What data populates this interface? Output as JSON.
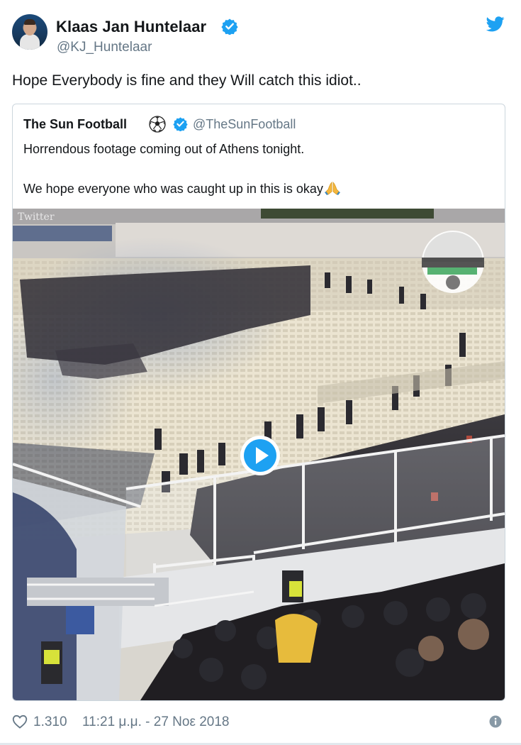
{
  "author": {
    "display_name": "Klaas Jan Huntelaar",
    "handle": "@KJ_Huntelaar",
    "verified": true
  },
  "tweet": {
    "text": "Hope Everybody is fine and they Will catch this idiot.."
  },
  "quoted_tweet": {
    "display_name": "The Sun Football",
    "name_emoji_icon": "soccer-ball-icon",
    "verified": true,
    "handle": "@TheSunFootball",
    "line1": "Horrendous footage coming out of Athens tonight.",
    "line2": "We hope everyone who was caught up in this is okay",
    "line2_emoji_icon": "folded-hands-icon",
    "media": {
      "type": "video",
      "watermark": "Twitter",
      "play_icon": "play-icon"
    }
  },
  "footer": {
    "likes": "1.310",
    "timestamp": "11:21 μ.μ. - 27 Νοε 2018",
    "like_icon": "heart-icon",
    "info_icon": "info-icon"
  },
  "colors": {
    "brand": "#1da1f2",
    "text": "#14171a",
    "secondary": "#657786",
    "border": "#ccd6dd"
  }
}
